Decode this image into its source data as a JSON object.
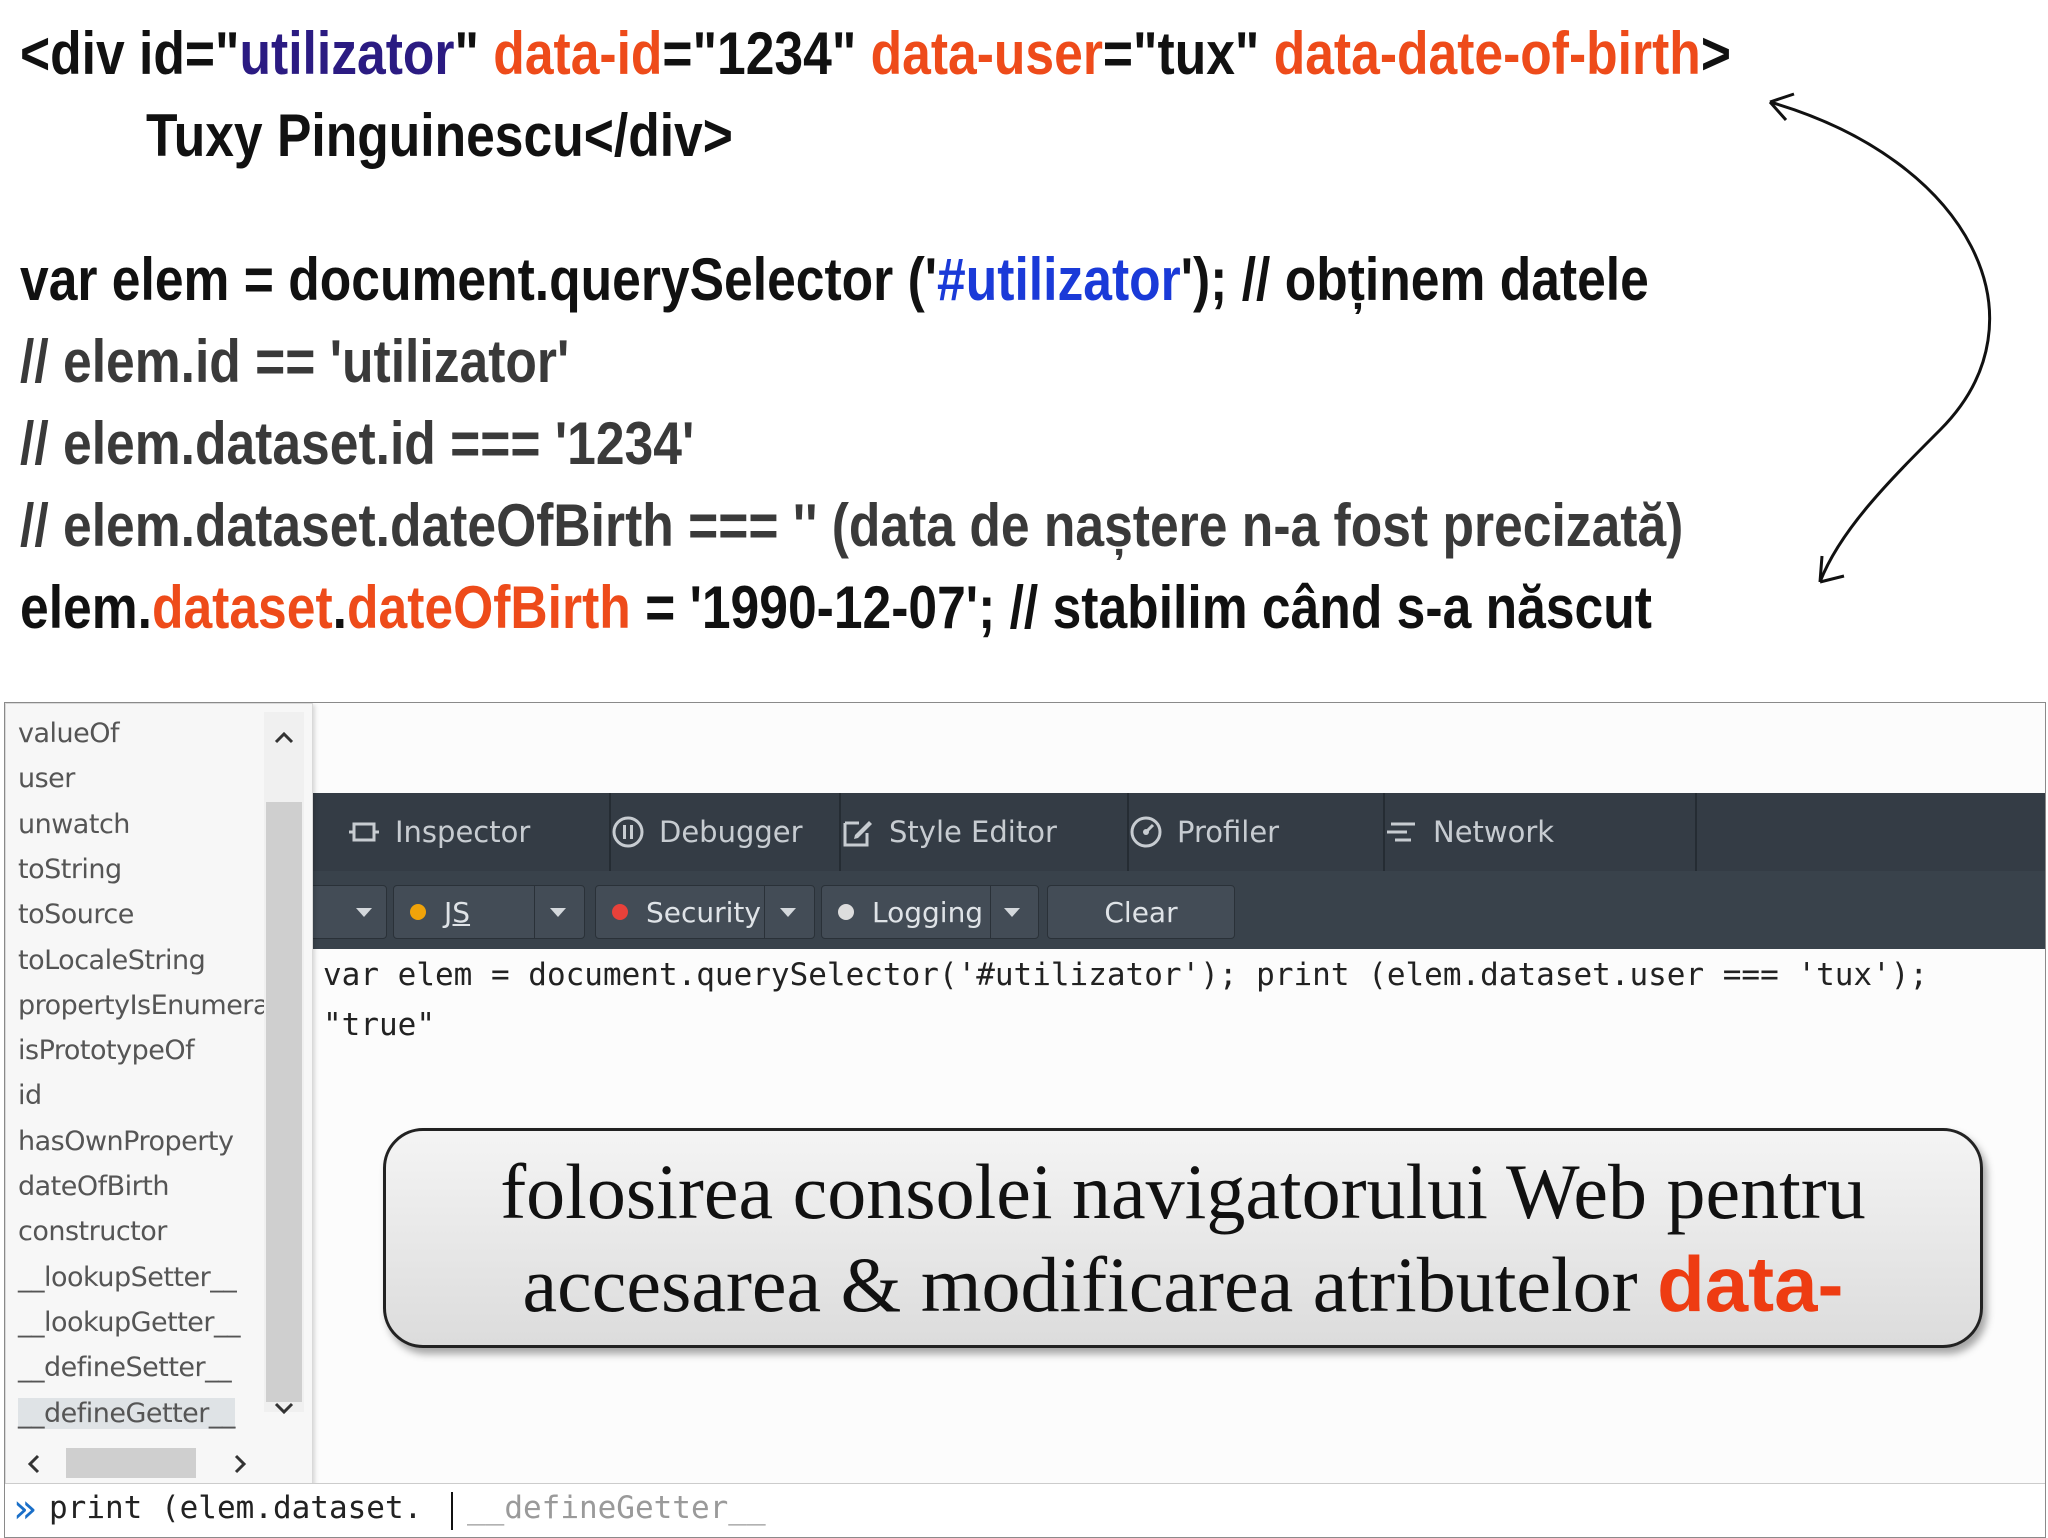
{
  "slide": {
    "line1": {
      "p1": "<div id=\"",
      "id_value": "utilizator",
      "p2": "\" ",
      "attr1": "data-id",
      "p3": "=\"1234\" ",
      "attr2": "data-user",
      "p4": "=\"tux\" ",
      "attr3": "data-date-of-birth",
      "p5": ">"
    },
    "line2": "Tuxy Pinguinescu</div>",
    "line3": {
      "p1": "var elem = document.querySelector ('",
      "selector": "#utilizator",
      "p2": "'); // obținem datele"
    },
    "line4": "// elem.id == 'utilizator'",
    "line5": "// elem.dataset.id === '1234'",
    "line6": "// elem.dataset.dateOfBirth === '' (data de naștere n-a fost precizată)",
    "line7": {
      "p1": "elem.",
      "dataset": "dataset",
      "dot": ".",
      "prop": "dateOfBirth",
      "p2": " = '1990-12-07'; // stabilim când s-a născut"
    }
  },
  "devtools": {
    "tabs": [
      {
        "label": "Inspector",
        "icon": "inspector-icon"
      },
      {
        "label": "Debugger",
        "icon": "debugger-icon"
      },
      {
        "label": "Style Editor",
        "icon": "style-editor-icon"
      },
      {
        "label": "Profiler",
        "icon": "profiler-icon"
      },
      {
        "label": "Network",
        "icon": "network-icon"
      }
    ],
    "filters": {
      "js": "JS",
      "security": "Security",
      "logging": "Logging",
      "clear": "Clear"
    },
    "colors": {
      "js_dot": "#f0a30a",
      "security_dot": "#e8413a",
      "logging_dot": "#dddddd"
    },
    "console_input": "var elem = document.querySelector('#utilizator'); print (elem.dataset.user === 'tux');",
    "console_output": "\"true\"",
    "autocomplete": [
      "valueOf",
      "user",
      "unwatch",
      "toString",
      "toSource",
      "toLocaleString",
      "propertyIsEnumera",
      "isPrototypeOf",
      "id",
      "hasOwnProperty",
      "dateOfBirth",
      "constructor",
      "__lookupSetter__",
      "__lookupGetter__",
      "__defineSetter__",
      "__defineGetter__"
    ],
    "prompt_symbol": "»",
    "input_typed": "print (elem.dataset.",
    "input_suggestion": "__defineGetter__"
  },
  "callout": {
    "line1": "folosirea consolei navigatorului Web pentru",
    "line2": "accesarea & modificarea atributelor ",
    "highlight": "data-"
  }
}
